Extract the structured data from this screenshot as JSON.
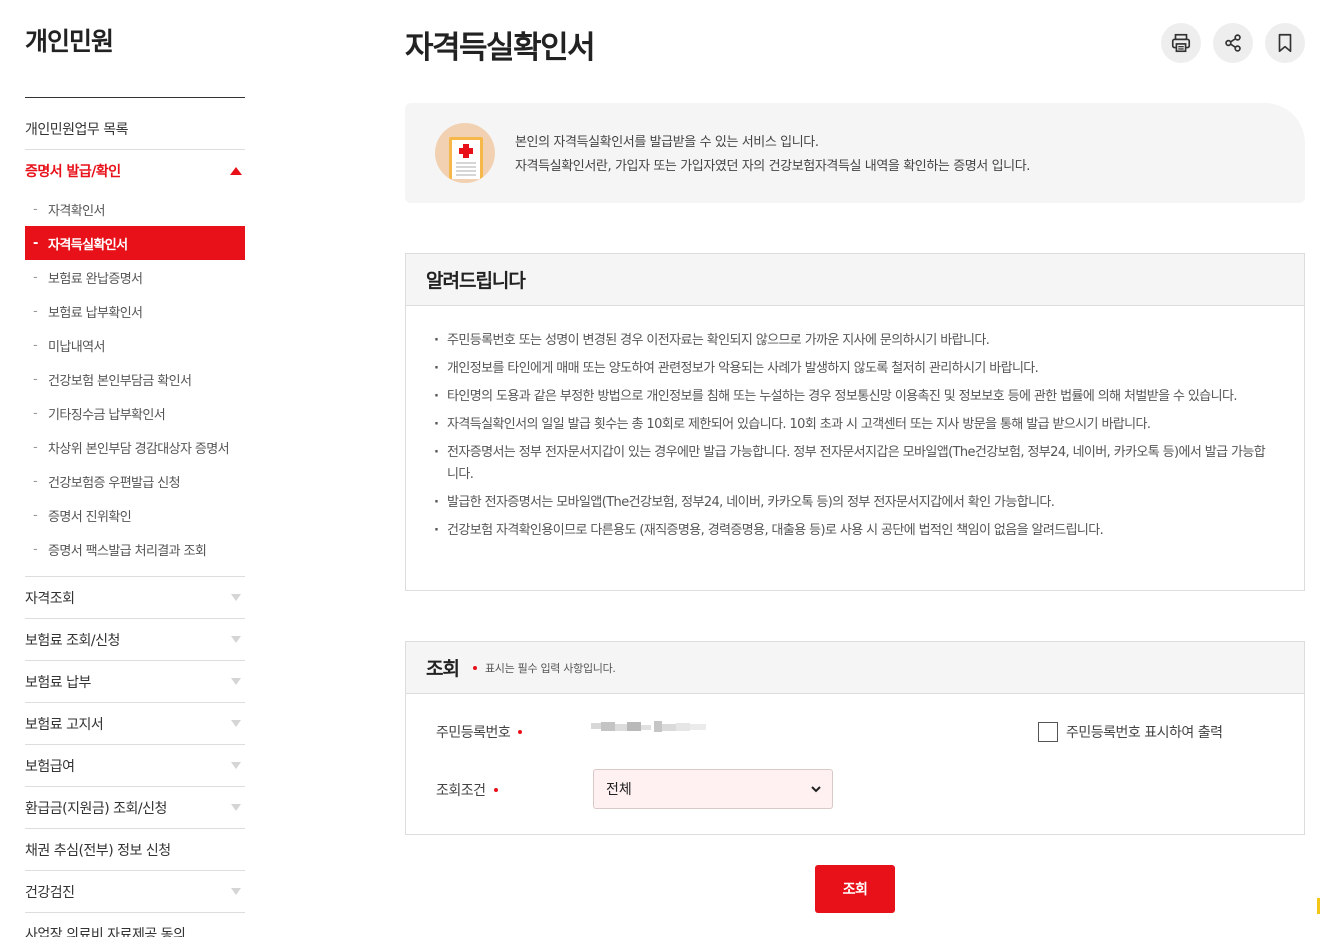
{
  "sidebar": {
    "title": "개인민원",
    "menu": [
      {
        "label": "개인민원업무 목록"
      },
      {
        "label": "증명서 발급/확인"
      }
    ],
    "sub_items": [
      {
        "label": "자격확인서"
      },
      {
        "label": "자격득실확인서"
      },
      {
        "label": "보험료 완납증명서"
      },
      {
        "label": "보험료 납부확인서"
      },
      {
        "label": "미납내역서"
      },
      {
        "label": "건강보험 본인부담금 확인서"
      },
      {
        "label": "기타징수금 납부확인서"
      },
      {
        "label": "차상위 본인부담 경감대상자 증명서"
      },
      {
        "label": "건강보험증 우편발급 신청"
      },
      {
        "label": "증명서 진위확인"
      },
      {
        "label": "증명서 팩스발급 처리결과 조회"
      }
    ],
    "menu_rest": [
      {
        "label": "자격조회"
      },
      {
        "label": "보험료 조회/신청"
      },
      {
        "label": "보험료 납부"
      },
      {
        "label": "보험료 고지서"
      },
      {
        "label": "보험급여"
      },
      {
        "label": "환급금(지원금) 조회/신청"
      },
      {
        "label": "채권 추심(전부) 정보 신청"
      },
      {
        "label": "건강검진"
      },
      {
        "label": "사업장 의료비 자료제공 동의"
      }
    ],
    "dash": "-"
  },
  "page": {
    "title": "자격득실확인서",
    "tools": [
      "print-icon",
      "share-icon",
      "bookmark-icon"
    ]
  },
  "intro": {
    "line1": "본인의 자격득실확인서를 발급받을 수 있는 서비스 입니다.",
    "line2": "자격득실확인서란, 가입자 또는 가입자였던 자의 건강보험자격득실 내역을 확인하는 증명서 입니다."
  },
  "notice": {
    "title": "알려드립니다",
    "items": [
      "주민등록번호 또는 성명이 변경된 경우 이전자료는 확인되지 않으므로 가까운 지사에 문의하시기 바랍니다.",
      "개인정보를 타인에게 매매 또는 양도하여 관련정보가 악용되는 사례가 발생하지 않도록 철저히 관리하시기 바랍니다.",
      "타인명의 도용과 같은 부정한 방법으로 개인정보를 침해 또는 누설하는 경우 정보통신망 이용촉진 및 정보보호 등에 관한 법률에 의해 처벌받을 수 있습니다.",
      "자격득실확인서의 일일 발급 횟수는 총 10회로 제한되어 있습니다. 10회 초과 시 고객센터 또는 지사 방문을 통해 발급 받으시기 바랍니다.",
      "전자증명서는 정부 전자문서지갑이 있는 경우에만 발급 가능합니다. 정부 전자문서지갑은 모바일앱(The건강보험, 정부24, 네이버, 카카오톡 등)에서 발급 가능합니다.",
      "발급한 전자증명서는 모바일앱(The건강보험, 정부24, 네이버, 카카오톡 등)의 정부 전자문서지갑에서 확인 가능합니다.",
      "건강보험 자격확인용이므로 다른용도 (재직증명용, 경력증명용, 대출용 등)로 사용 시 공단에 법적인 책임이 없음을 알려드립니다."
    ]
  },
  "query": {
    "title": "조회",
    "required_note": "표시는 필수 입력 사항입니다.",
    "rrn_label": "주민등록번호",
    "rrn_print_label": "주민등록번호 표시하여 출력",
    "condition_label": "조회조건",
    "condition_value": "전체",
    "submit_label": "조회"
  },
  "colors": {
    "accent": "#e8111a",
    "panel_bg": "#f5f5f5"
  }
}
